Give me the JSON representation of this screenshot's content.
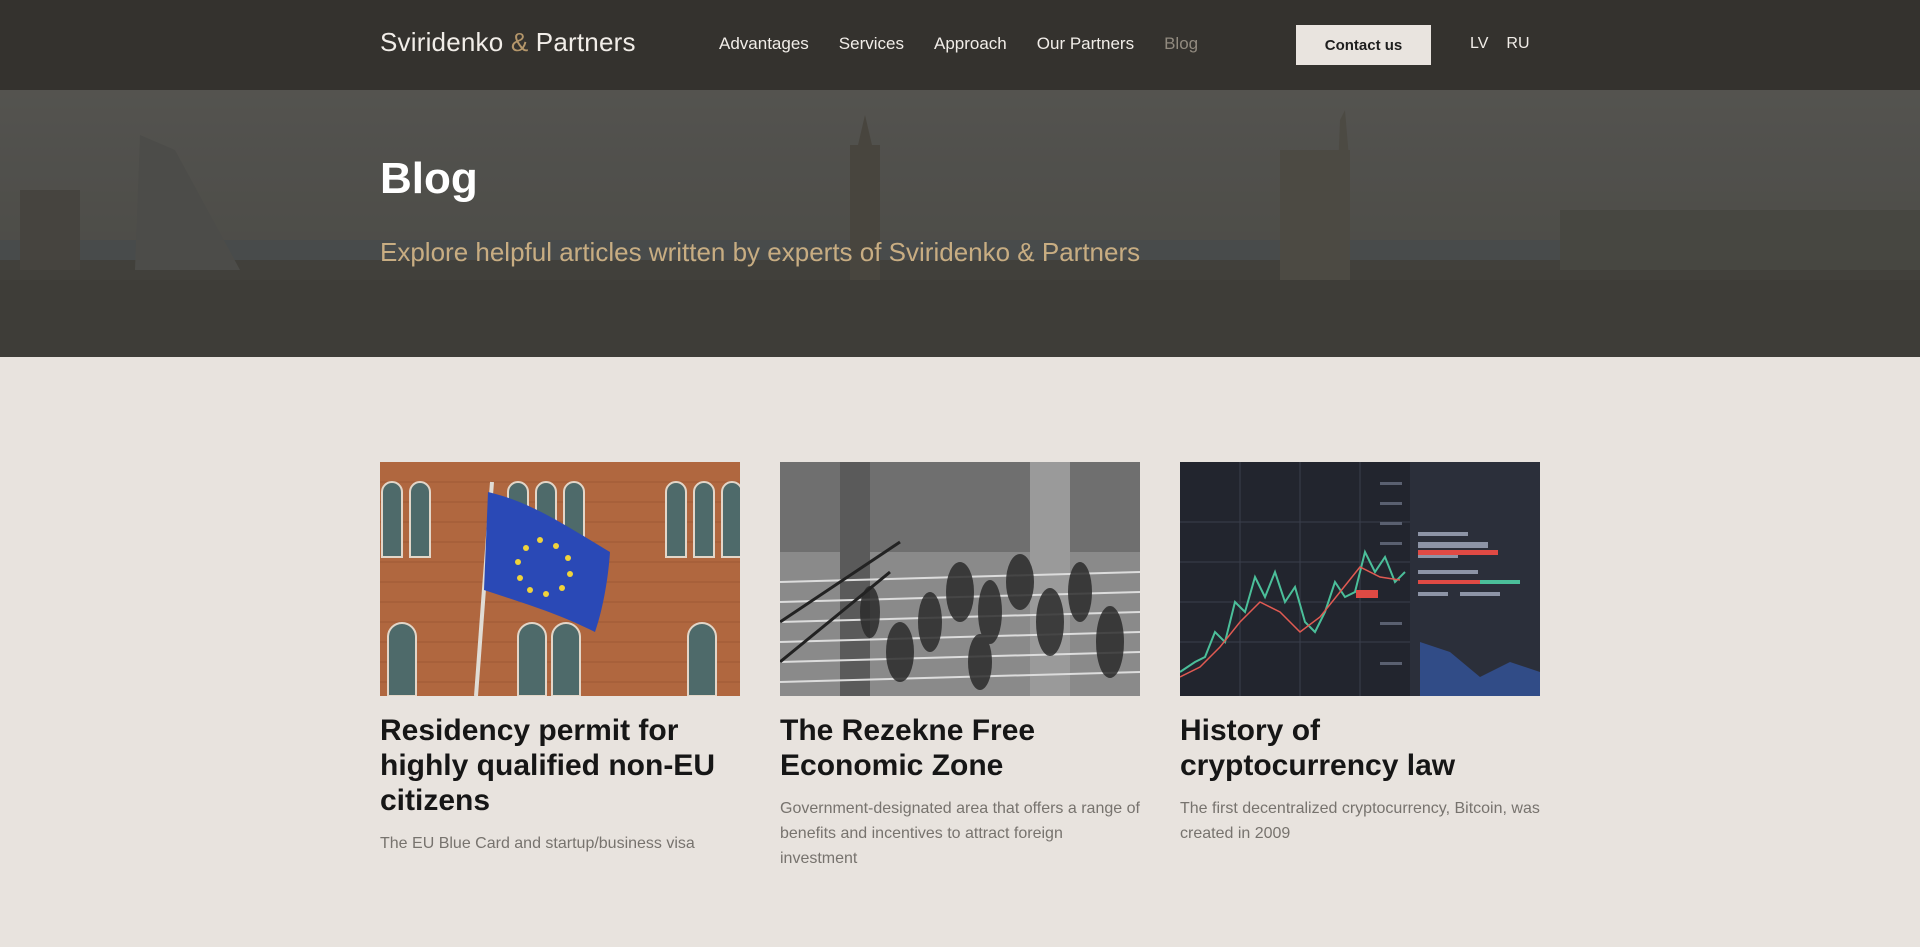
{
  "header": {
    "logo_left": "Sviridenko ",
    "logo_amp": "&",
    "logo_right": " Partners",
    "nav": [
      "Advantages",
      "Services",
      "Approach",
      "Our Partners",
      "Blog"
    ],
    "active_nav": "Blog",
    "contact_label": "Contact us",
    "languages": [
      "LV",
      "RU"
    ]
  },
  "hero": {
    "title": "Blog",
    "subtitle": "Explore helpful articles written by experts of Sviridenko & Partners"
  },
  "posts": [
    {
      "image": "eu-flag-on-brick-building",
      "title": "Residency permit for highly qualified non-EU citizens",
      "description": "The EU Blue Card and startup/business visa"
    },
    {
      "image": "crowd-on-stairs-black-and-white",
      "title": "The Rezekne Free Economic Zone",
      "description": "Government-designated area that offers a range of benefits and incentives to attract foreign investment"
    },
    {
      "image": "crypto-trading-chart-screen",
      "title": "History of cryptocurrency law",
      "description": "The first decentralized cryptocurrency, Bitcoin, was created in 2009"
    }
  ],
  "colors": {
    "header_bg": "#34322e",
    "page_bg": "#e8e3de",
    "accent_gold": "#b4966a",
    "nav_active": "#918a7f"
  }
}
